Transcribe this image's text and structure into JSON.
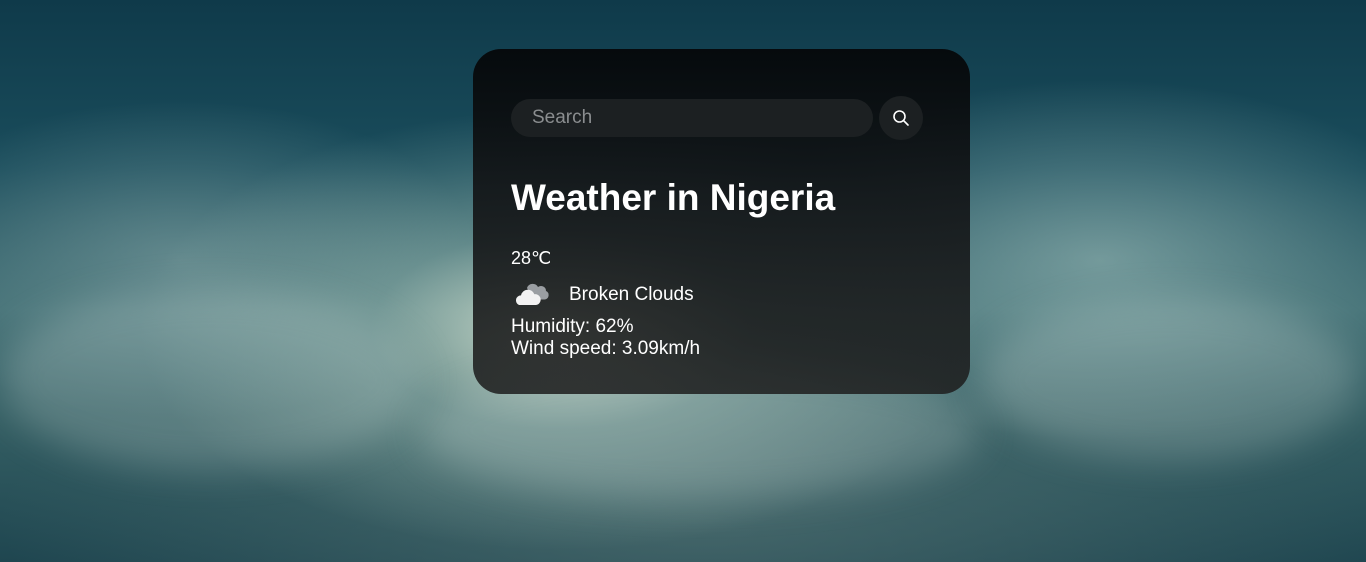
{
  "search": {
    "placeholder": "Search",
    "button_icon": "search-icon"
  },
  "weather": {
    "title": "Weather in Nigeria",
    "temperature": "28℃",
    "condition_icon": "cloud-icon",
    "description": "Broken Clouds",
    "humidity": "Humidity: 62%",
    "wind": "Wind speed: 3.09km/h"
  },
  "colors": {
    "card_background": "#0b0e10",
    "input_background": "#1c2022",
    "text": "#ffffff"
  }
}
